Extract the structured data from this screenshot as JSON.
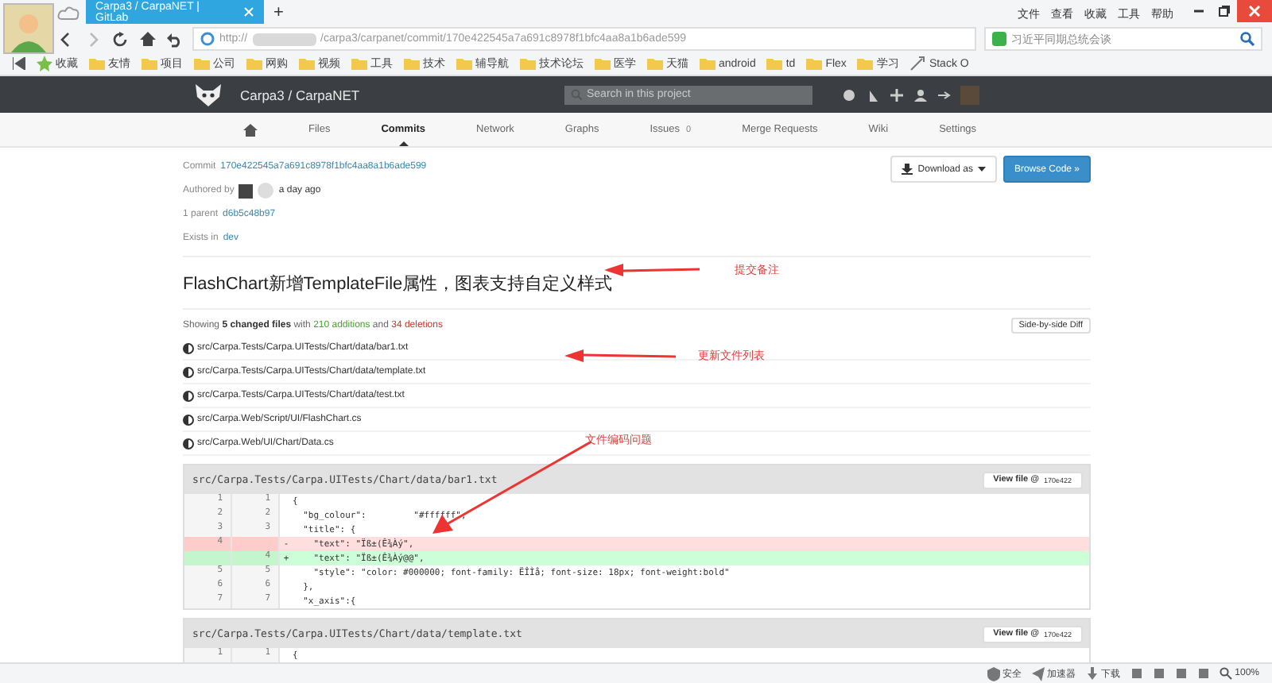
{
  "browser": {
    "tabs": [
      {
        "label": "Carpa3 / CarpaNET | GitLab",
        "selected": true
      }
    ],
    "new_tab": "+",
    "menu": [
      "文件",
      "查看",
      "收藏",
      "工具",
      "帮助"
    ],
    "address": {
      "scheme": "http://",
      "path": "/carpa3/carpanet/commit/170e422545a7a691c8978f1bfc4aa8a1b6ade599"
    },
    "search": {
      "value": "习近平同期总统会谈"
    },
    "bookmarks": [
      {
        "label": "收藏",
        "kind": "star"
      },
      {
        "label": "友情",
        "kind": "folder"
      },
      {
        "label": "项目",
        "kind": "folder"
      },
      {
        "label": "公司",
        "kind": "folder"
      },
      {
        "label": "网购",
        "kind": "folder"
      },
      {
        "label": "视频",
        "kind": "folder"
      },
      {
        "label": "工具",
        "kind": "folder"
      },
      {
        "label": "技术",
        "kind": "folder"
      },
      {
        "label": "辅导航",
        "kind": "folder"
      },
      {
        "label": "技术论坛",
        "kind": "folder"
      },
      {
        "label": "医学",
        "kind": "folder"
      },
      {
        "label": "天猫",
        "kind": "folder"
      },
      {
        "label": "android",
        "kind": "folder"
      },
      {
        "label": "td",
        "kind": "folder"
      },
      {
        "label": "Flex",
        "kind": "folder"
      },
      {
        "label": "学习",
        "kind": "folder"
      },
      {
        "label": "Stack O",
        "kind": "link"
      }
    ]
  },
  "header": {
    "project": "Carpa3 / CarpaNET",
    "search": {
      "placeholder": "Search in this project"
    }
  },
  "nav": [
    {
      "label": "Files",
      "selected": false
    },
    {
      "label": "Commits",
      "selected": true
    },
    {
      "label": "Network",
      "selected": false
    },
    {
      "label": "Graphs",
      "selected": false
    },
    {
      "label": "Issues",
      "badge": "0",
      "selected": false
    },
    {
      "label": "Merge Requests",
      "selected": false
    },
    {
      "label": "Wiki",
      "selected": false
    },
    {
      "label": "Settings",
      "selected": false
    }
  ],
  "commit": {
    "label": "Commit",
    "sha": "170e422545a7a691c8978f1bfc4aa8a1b6ade599",
    "authored_by": "Authored by",
    "time": "a day ago",
    "parent_label": "1 parent",
    "parent": "d6b5c48b97",
    "exists_label": "Exists in",
    "branch": "dev",
    "download": "Download as",
    "browse": "Browse Code »",
    "title": "FlashChart新增TemplateFile属性，图表支持自定义样式"
  },
  "summary": {
    "text": "Showing **5 changed files** with",
    "additions": "210 additions",
    "and": "and",
    "deletions": "34 deletions",
    "toggle": "Side-by-side Diff"
  },
  "files": [
    "src/Carpa.Tests/Carpa.UITests/Chart/data/bar1.txt",
    "src/Carpa.Tests/Carpa.UITests/Chart/data/template.txt",
    "src/Carpa.Tests/Carpa.UITests/Chart/data/test.txt",
    "src/Carpa.Web/Script/UI/FlashChart.cs",
    "src/Carpa.Web/UI/Chart/Data.cs"
  ],
  "diffs": [
    {
      "path": "src/Carpa.Tests/Carpa.UITests/Chart/data/bar1.txt",
      "view": "View file @",
      "ref": "170e422",
      "lines": [
        {
          "kind": "same",
          "old": "1",
          "new": "1",
          "code": "{"
        },
        {
          "kind": "same",
          "old": "2",
          "new": "2",
          "code": "  \"bg_colour\":         \"#ffffff\","
        },
        {
          "kind": "same",
          "old": "3",
          "new": "3",
          "code": "  \"title\": {"
        },
        {
          "kind": "del",
          "old": "4",
          "sign": "-",
          "code": "    \"text\": \"Ïß±(Ê¾Àý\","
        },
        {
          "kind": "add",
          "new": "4",
          "sign": "+",
          "code": "    \"text\": \"Ïß±(Ê¾Àý@@\","
        },
        {
          "kind": "same",
          "old": "5",
          "new": "5",
          "code": "    \"style\": \"color: #000000; font-family: ËÎÌå; font-size: 18px; font-weight:bold\""
        },
        {
          "kind": "same",
          "old": "6",
          "new": "6",
          "code": "  },"
        },
        {
          "kind": "same",
          "old": "7",
          "new": "7",
          "code": "  \"x_axis\":{"
        }
      ]
    },
    {
      "path": "src/Carpa.Tests/Carpa.UITests/Chart/data/template.txt",
      "view": "View file @",
      "ref": "170e422",
      "lines": [
        {
          "kind": "same",
          "old": "1",
          "new": "1",
          "code": "{"
        }
      ]
    }
  ],
  "annotations": [
    {
      "text": "提交备注",
      "kind": "title"
    },
    {
      "text": "更新文件列表",
      "kind": "files"
    },
    {
      "text": "文件编码问题",
      "kind": "code"
    }
  ],
  "status_bar": {
    "items": [
      "安全",
      "加速器",
      "下载"
    ],
    "zoom": "100%"
  }
}
